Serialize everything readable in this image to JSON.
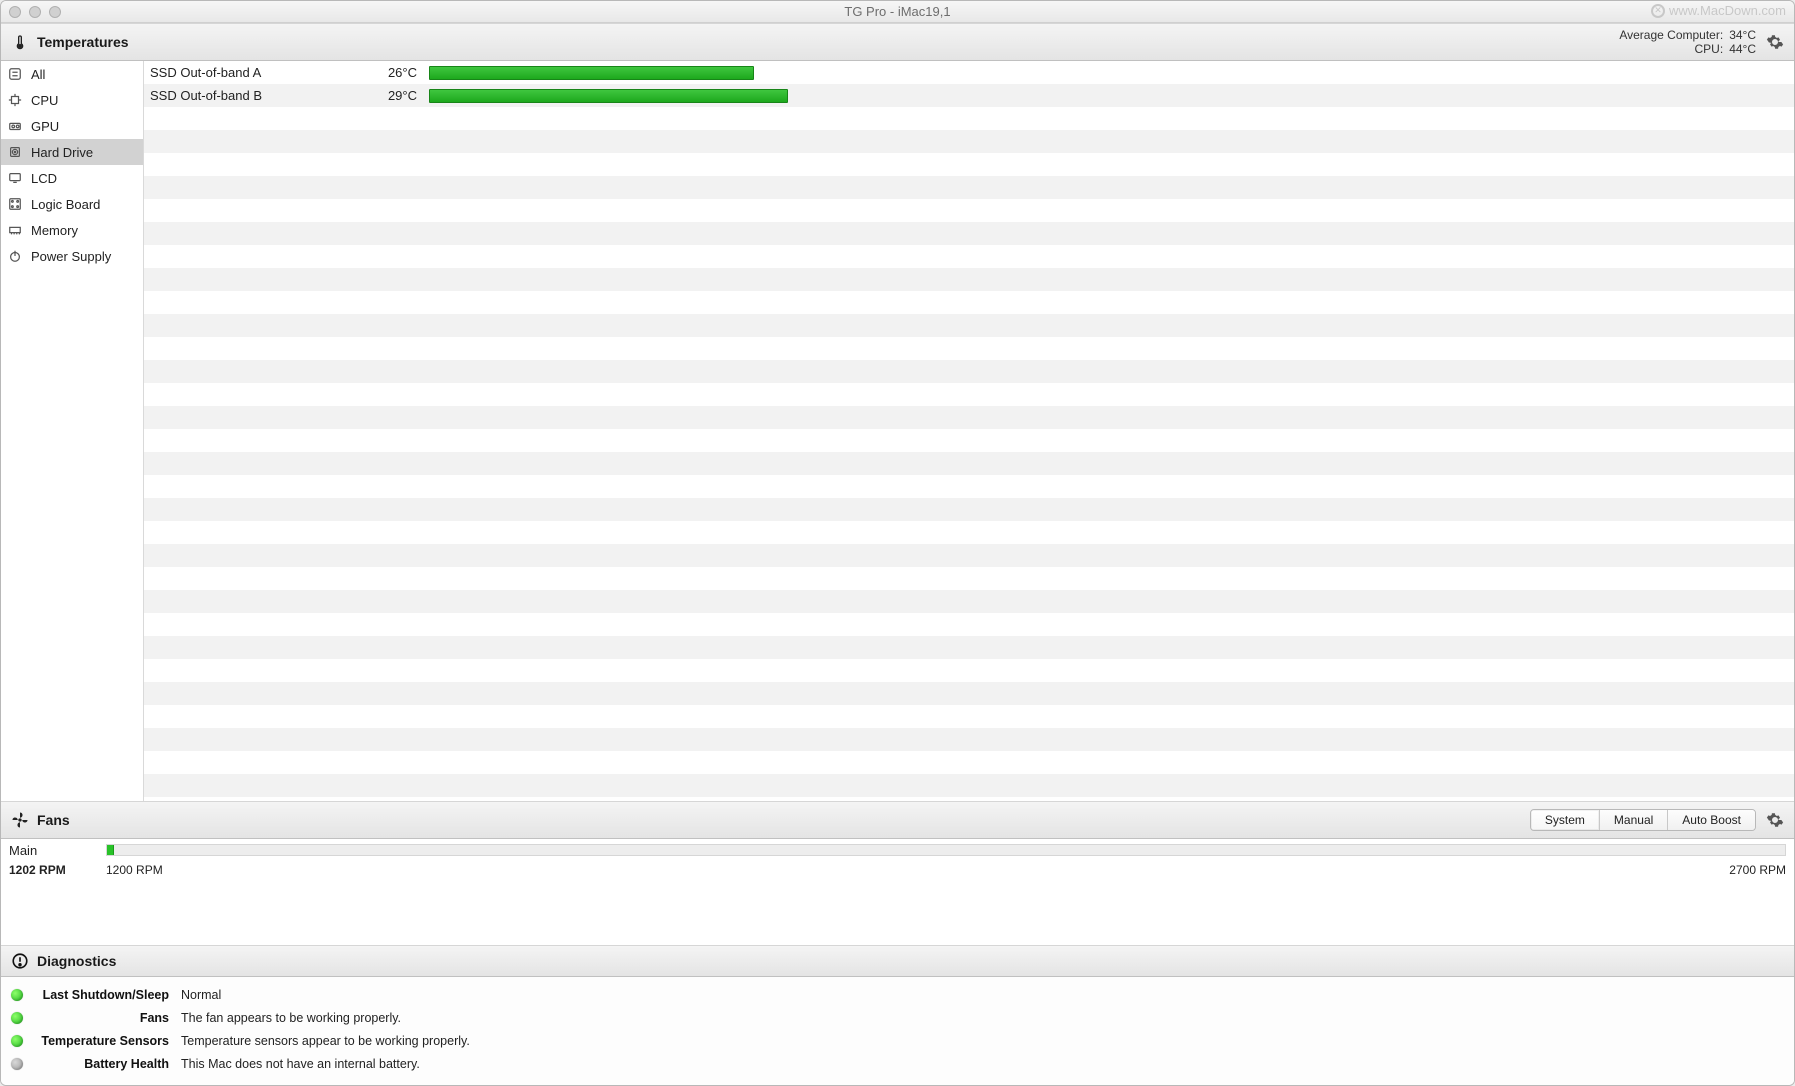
{
  "window": {
    "title": "TG Pro - iMac19,1",
    "watermark": "www.MacDown.com"
  },
  "sections": {
    "temperatures": "Temperatures",
    "fans": "Fans",
    "diagnostics": "Diagnostics"
  },
  "averages": {
    "computer_label": "Average Computer:",
    "computer_value": "34°C",
    "cpu_label": "CPU:",
    "cpu_value": "44°C"
  },
  "sidebar": {
    "items": [
      {
        "label": "All",
        "icon": "all"
      },
      {
        "label": "CPU",
        "icon": "cpu"
      },
      {
        "label": "GPU",
        "icon": "gpu"
      },
      {
        "label": "Hard Drive",
        "icon": "hdd"
      },
      {
        "label": "LCD",
        "icon": "lcd"
      },
      {
        "label": "Logic Board",
        "icon": "board"
      },
      {
        "label": "Memory",
        "icon": "memory"
      },
      {
        "label": "Power Supply",
        "icon": "power"
      }
    ],
    "selected_index": 3
  },
  "sensors": [
    {
      "name": "SSD Out-of-band A",
      "temp": "26°C",
      "percent": 24
    },
    {
      "name": "SSD Out-of-band B",
      "temp": "29°C",
      "percent": 26.5
    }
  ],
  "empty_row_count": 30,
  "fans": {
    "modes": [
      {
        "label": "System",
        "active": true
      },
      {
        "label": "Manual",
        "active": false
      },
      {
        "label": "Auto Boost",
        "active": false
      }
    ],
    "rows": [
      {
        "name": "Main",
        "current": "1202 RPM",
        "min": "1200 RPM",
        "max": "2700 RPM",
        "fill_percent": 0.4
      }
    ]
  },
  "diagnostics": [
    {
      "status": "green",
      "label": "Last Shutdown/Sleep",
      "value": "Normal"
    },
    {
      "status": "green",
      "label": "Fans",
      "value": "The fan appears to be working properly."
    },
    {
      "status": "green",
      "label": "Temperature Sensors",
      "value": "Temperature sensors appear to be working properly."
    },
    {
      "status": "grey",
      "label": "Battery Health",
      "value": "This Mac does not have an internal battery."
    }
  ]
}
